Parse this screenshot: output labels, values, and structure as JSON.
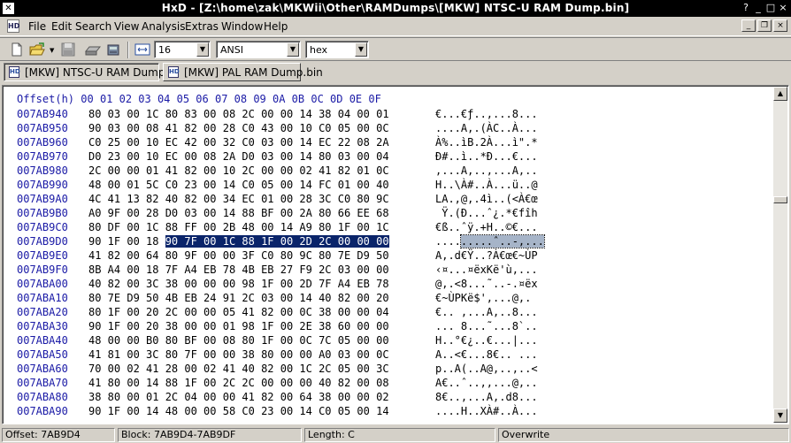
{
  "window": {
    "title": "HxD - [Z:\\home\\zak\\MKWii\\Other\\RAMDumps\\[MKW] NTSC-U RAM Dump.bin]",
    "app_icon": "hxd-app-icon",
    "buttons": {
      "help": "?",
      "minimize": "_",
      "maximize": "□",
      "close": "×"
    }
  },
  "menubar": {
    "items": [
      "File",
      "Edit",
      "Search",
      "View",
      "Analysis",
      "Extras",
      "Window",
      "Help"
    ],
    "mdi_buttons": {
      "minimize": "_",
      "restore": "❐",
      "close": "×"
    }
  },
  "toolbar": {
    "icons": [
      "new-file-icon",
      "open-folder-icon",
      "save-icon",
      "open-disk-icon",
      "open-ram-icon",
      "bytes-per-row-icon"
    ],
    "bytes_per_row": "16",
    "charset": "ANSI",
    "offset_base": "hex"
  },
  "tabs": [
    {
      "label": "[MKW] NTSC-U RAM Dump.bin",
      "active": true
    },
    {
      "label": "[MKW] PAL RAM Dump.bin",
      "active": false
    }
  ],
  "hexview": {
    "header_label": "Offset(h)",
    "columns": "00 01 02 03 04 05 06 07 08 09 0A 0B 0C 0D 0E 0F",
    "rows": [
      {
        "offset": "007AB940",
        "bytes": "80 03 00 1C 80 83 00 08 2C 00 00 14 38 04 00 01",
        "text": "€...€ƒ..,...8..."
      },
      {
        "offset": "007AB950",
        "bytes": "90 03 00 08 41 82 00 28 C0 43 00 10 C0 05 00 0C",
        "text": "....A‚.(ÀC..À..."
      },
      {
        "offset": "007AB960",
        "bytes": "C0 25 00 10 EC 42 00 32 C0 03 00 14 EC 22 08 2A",
        "text": "À%..ìB.2À...ì\".*"
      },
      {
        "offset": "007AB970",
        "bytes": "D0 23 00 10 EC 00 08 2A D0 03 00 14 80 03 00 04",
        "text": "Ð#..ì..*Ð...€..."
      },
      {
        "offset": "007AB980",
        "bytes": "2C 00 00 01 41 82 00 10 2C 00 00 02 41 82 01 0C",
        "text": ",...A‚..,...A‚.."
      },
      {
        "offset": "007AB990",
        "bytes": "48 00 01 5C C0 23 00 14 C0 05 00 14 FC 01 00 40",
        "text": "H..\\À#..À...ü..@"
      },
      {
        "offset": "007AB9A0",
        "bytes": "4C 41 13 82 40 82 00 34 EC 01 00 28 3C C0 80 9C",
        "text": "LA.‚@‚.4ì..(<À€œ"
      },
      {
        "offset": "007AB9B0",
        "bytes": "A0 9F 00 28 D0 03 00 14 88 BF 00 2A 80 66 EE 68",
        "text": " Ÿ.(Ð...ˆ¿.*€fîh"
      },
      {
        "offset": "007AB9C0",
        "bytes": "80 DF 00 1C 88 FF 00 2B 48 00 14 A9 80 1F 00 1C",
        "text": "€ß..ˆÿ.+H..©€..."
      },
      {
        "offset": "007AB9D0",
        "bytes_pre": "90 1F 00 18 ",
        "bytes_sel": "90 7F 00 1C 88 1F 00 2D 2C 00 00 00",
        "text_pre": "....",
        "text_sel": ".....ˆ..-,..."
      },
      {
        "offset": "007AB9E0",
        "bytes": "41 82 00 64 80 9F 00 00 3F C0 80 9C 80 7E D9 50",
        "text": "A‚.d€Ÿ..?À€œ€~ÙP"
      },
      {
        "offset": "007AB9F0",
        "bytes": "8B A4 00 18 7F A4 EB 78 4B EB 27 F9 2C 03 00 00",
        "text": "‹¤...¤ëxKë'ù,..."
      },
      {
        "offset": "007ABA00",
        "bytes": "40 82 00 3C 38 00 00 00 98 1F 00 2D 7F A4 EB 78",
        "text": "@‚.<8...˜..-.¤ëx"
      },
      {
        "offset": "007ABA10",
        "bytes": "80 7E D9 50 4B EB 24 91 2C 03 00 14 40 82 00 20",
        "text": "€~ÙPKë$',...@‚. "
      },
      {
        "offset": "007ABA20",
        "bytes": "80 1F 00 20 2C 00 00 05 41 82 00 0C 38 00 00 04",
        "text": "€.. ,...A‚..8..."
      },
      {
        "offset": "007ABA30",
        "bytes": "90 1F 00 20 38 00 00 01 98 1F 00 2E 38 60 00 00",
        "text": "... 8...˜...8`.."
      },
      {
        "offset": "007ABA40",
        "bytes": "48 00 00 B0 80 BF 00 08 80 1F 00 0C 7C 05 00 00",
        "text": "H..°€¿..€...|..."
      },
      {
        "offset": "007ABA50",
        "bytes": "41 81 00 3C 80 7F 00 00 38 80 00 00 A0 03 00 0C",
        "text": "A..<€...8€.. ..."
      },
      {
        "offset": "007ABA60",
        "bytes": "70 00 02 41 28 00 02 41 40 82 00 1C 2C 05 00 3C",
        "text": "p..A(..A@‚..,..<"
      },
      {
        "offset": "007ABA70",
        "bytes": "41 80 00 14 88 1F 00 2C 2C 00 00 00 40 82 00 08",
        "text": "A€..ˆ..,,...@‚.."
      },
      {
        "offset": "007ABA80",
        "bytes": "38 80 00 01 2C 04 00 00 41 82 00 64 38 00 00 02",
        "text": "8€..,...A‚.d8..."
      },
      {
        "offset": "007ABA90",
        "bytes": "90 1F 00 14 48 00 00 58 C0 23 00 14 C0 05 00 14",
        "text": "....H..XÀ#..À..."
      }
    ]
  },
  "statusbar": {
    "offset": "Offset: 7AB9D4",
    "block": "Block: 7AB9D4-7AB9DF",
    "length": "Length: C",
    "mode": "Overwrite"
  },
  "colors": {
    "offset_blue": "#1a1aa6",
    "selection": "#0a246a",
    "text_selection": "#a6b4c8"
  }
}
